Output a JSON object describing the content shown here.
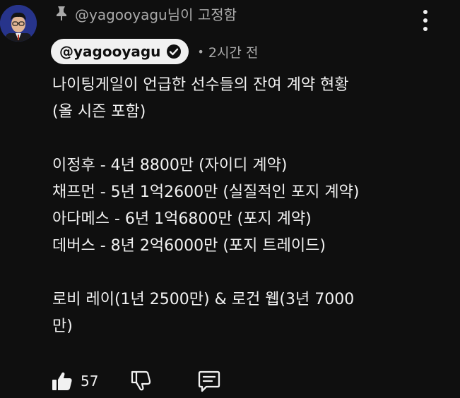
{
  "header": {
    "pinned_text": "@yagooyagu님이 고정함"
  },
  "author": {
    "handle": "@yagooyagu",
    "timestamp": "2시간 전"
  },
  "comment": {
    "lines": [
      "나이팅게일이 언급한 선수들의 잔여 계약 현황",
      "(올 시즌 포함)",
      "",
      "이정후 - 4년 8800만 (자이디 계약)",
      "채프먼 - 5년 1억2600만 (실질적인 포지 계약)",
      "아다메스 - 6년 1억6800만 (포지 계약)",
      "데버스 - 8년 2억6000만 (포지 트레이드)",
      "",
      "로비 레이(1년 2500만) & 로건 웹(3년 7000",
      "만)"
    ]
  },
  "actions": {
    "like_count": "57"
  },
  "icons": {
    "pin": "pin-icon",
    "more": "more-vert-icon",
    "verified": "verified-check-icon",
    "like": "thumb-up-icon",
    "dislike": "thumb-down-icon",
    "reply": "reply-comment-icon"
  }
}
